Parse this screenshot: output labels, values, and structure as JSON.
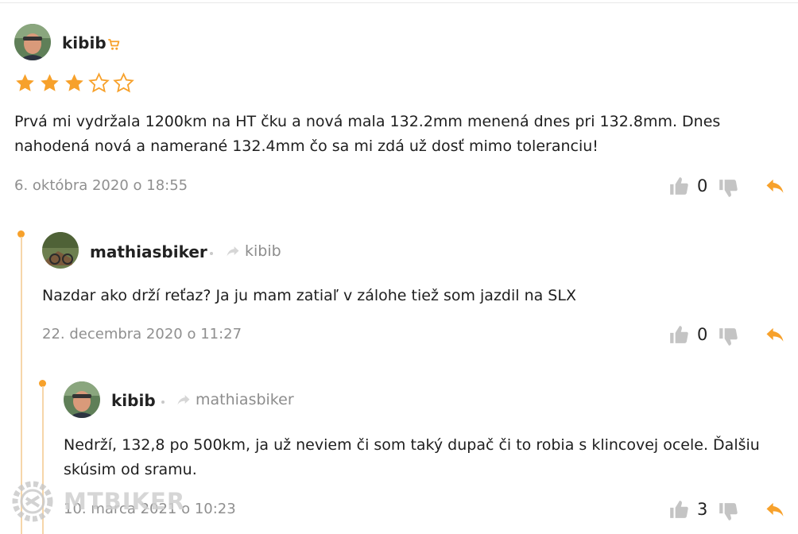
{
  "comments": [
    {
      "author": "kibib",
      "badge_icon": "cart-icon",
      "rating": 3,
      "rating_max": 5,
      "text_lines": [
        "Prvá mi vydržala 1200km na HT čku a nová mala 132.2mm menená dnes pri 132.8mm. Dnes",
        "nahodená nová a namerané 132.4mm čo sa mi zdá už dosť mimo toleranciu!"
      ],
      "date": "6. októbra 2020 o 18:55",
      "likes": "0"
    },
    {
      "author": "mathiasbiker",
      "reply_to": "kibib",
      "text_lines": [
        "Nazdar ako drží reťaz? Ja ju mam zatiaľ v zálohe tiež som jazdil na SLX"
      ],
      "date": "22. decembra 2020 o 11:27",
      "likes": "0"
    },
    {
      "author": "kibib",
      "reply_to": "mathiasbiker",
      "text_lines": [
        "Nedrží, 132,8 po 500km, ja už neviem či som taký dupač či to robia s klincovej ocele. Ďalšiu",
        "skúsim od sramu."
      ],
      "date": "10. marca 2021 o 10:23",
      "likes": "3"
    }
  ],
  "watermark": "MTBIKER",
  "colors": {
    "accent": "#f7a12b",
    "muted": "#8f8f8f",
    "thread": "#f6d6a9",
    "icon_gray": "#c4c4c4"
  }
}
